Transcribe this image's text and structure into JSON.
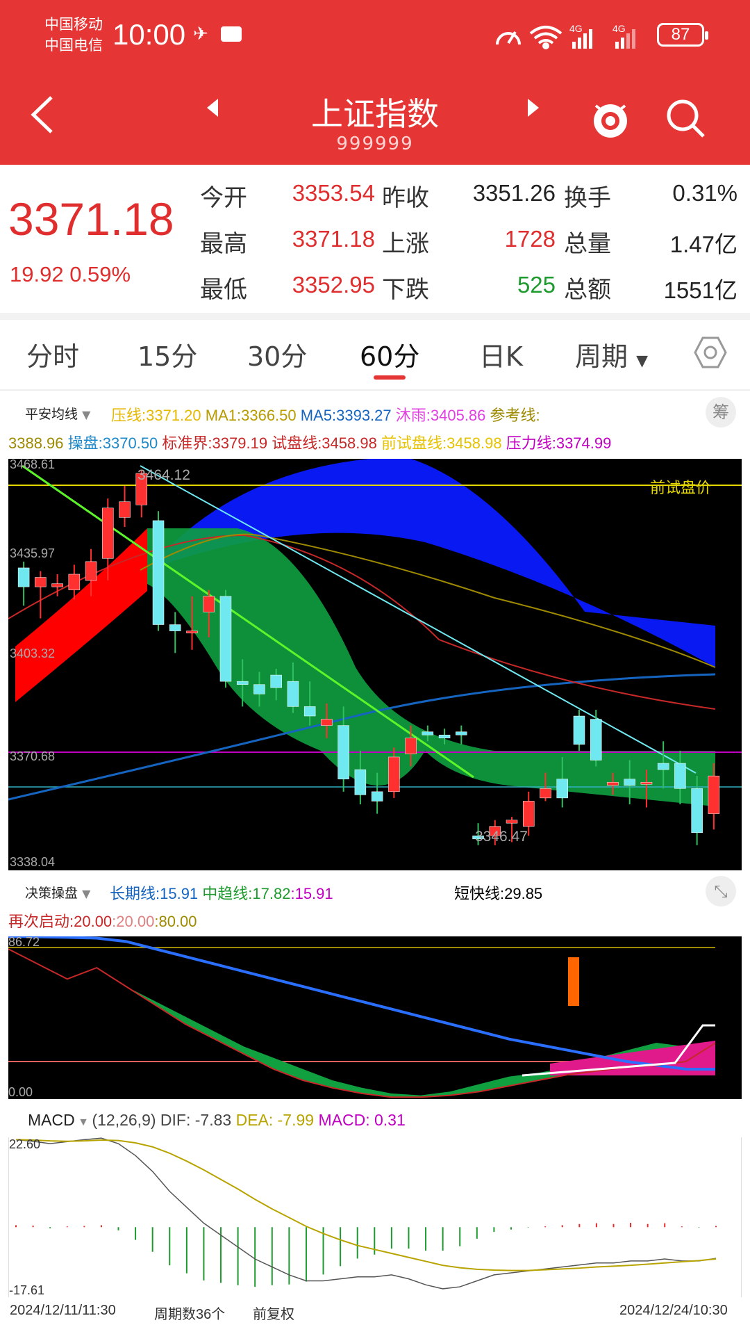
{
  "status_bar": {
    "carrier1": "中国移动",
    "carrier2": "中国电信",
    "time": "10:00",
    "battery": "87"
  },
  "nav": {
    "title": "上证指数",
    "code": "999999"
  },
  "quote": {
    "last_price": "3371.18",
    "change": "19.92 0.59%",
    "fields": [
      {
        "label": "今开",
        "value": "3353.54",
        "color": "red"
      },
      {
        "label": "昨收",
        "value": "3351.26",
        "color": "black"
      },
      {
        "label": "换手",
        "value": "0.31%",
        "color": "black"
      },
      {
        "label": "最高",
        "value": "3371.18",
        "color": "red"
      },
      {
        "label": "上涨",
        "value": "1728",
        "color": "red"
      },
      {
        "label": "总量",
        "value": "1.47亿",
        "color": "black"
      },
      {
        "label": "最低",
        "value": "3352.95",
        "color": "red"
      },
      {
        "label": "下跌",
        "value": "525",
        "color": "green"
      },
      {
        "label": "总额",
        "value": "1551亿",
        "color": "black"
      }
    ]
  },
  "tabs": [
    "分时",
    "15分",
    "30分",
    "60分",
    "日K",
    "周期"
  ],
  "active_tab": "60分",
  "main_indicator": {
    "name": "平安均线",
    "items_row1": [
      {
        "text": "压线:3371.20",
        "color": "#e6b800"
      },
      {
        "text": "MA1:3366.50",
        "color": "#b89b00"
      },
      {
        "text": "MA5:3393.27",
        "color": "#1565c0"
      },
      {
        "text": "沐雨:3405.86",
        "color": "#e040e0"
      },
      {
        "text": "参考线:",
        "color": "#9e8a00"
      }
    ],
    "items_row2": [
      {
        "text": "3388.96",
        "color": "#9e8a00"
      },
      {
        "text": "操盘:3370.50",
        "color": "#1e88c8"
      },
      {
        "text": "标准界:3379.19",
        "color": "#c62828"
      },
      {
        "text": "试盘线:3458.98",
        "color": "#c62828"
      },
      {
        "text": "前试盘线:3458.98",
        "color": "#e6c200"
      },
      {
        "text": "压力线:3374.99",
        "color": "#c000c0"
      }
    ],
    "ctl_label": "筹"
  },
  "main_chart": {
    "y_top": "3468.61",
    "y_2": "3435.97",
    "y_3": "3403.32",
    "y_4": "3370.68",
    "y_bottom": "3338.04",
    "high_label": "3464.12",
    "low_label": "3346.47",
    "ref_label": "前试盘价",
    "ylim": [
      3338.04,
      3468.61
    ],
    "candles": [
      [
        3434,
        3428,
        3436,
        3422
      ],
      [
        3428,
        3431,
        3433,
        3418
      ],
      [
        3428,
        3429,
        3432,
        3425
      ],
      [
        3427,
        3432,
        3435,
        3424
      ],
      [
        3430,
        3436,
        3440,
        3425
      ],
      [
        3437,
        3453,
        3456,
        3430
      ],
      [
        3450,
        3455,
        3460,
        3447
      ],
      [
        3454,
        3464,
        3465,
        3450
      ],
      [
        3449,
        3416,
        3452,
        3414
      ],
      [
        3416,
        3414,
        3420,
        3407
      ],
      [
        3414,
        3414,
        3425,
        3408
      ],
      [
        3420,
        3425,
        3427,
        3412
      ],
      [
        3425,
        3398,
        3427,
        3396
      ],
      [
        3398,
        3397,
        3405,
        3390
      ],
      [
        3397,
        3394,
        3401,
        3390
      ],
      [
        3400,
        3396,
        3402,
        3392
      ],
      [
        3398,
        3390,
        3404,
        3388
      ],
      [
        3390,
        3387,
        3398,
        3384
      ],
      [
        3384,
        3386,
        3391,
        3380
      ],
      [
        3384,
        3367,
        3390,
        3363
      ],
      [
        3370,
        3362,
        3376,
        3359
      ],
      [
        3363,
        3360,
        3369,
        3356
      ],
      [
        3363,
        3374,
        3377,
        3361
      ],
      [
        3375,
        3380,
        3384,
        3371
      ],
      [
        3382,
        3381,
        3384,
        3379
      ],
      [
        3381,
        3380,
        3383,
        3378
      ],
      [
        3382,
        3381,
        3384,
        3378
      ],
      [
        3349,
        3348,
        3353,
        3346
      ],
      [
        3349,
        3352,
        3354,
        3346
      ],
      [
        3353,
        3354,
        3355,
        3347
      ],
      [
        3352,
        3360,
        3363,
        3349
      ],
      [
        3361,
        3364,
        3369,
        3360
      ],
      [
        3367,
        3361,
        3374,
        3358
      ],
      [
        3387,
        3378,
        3389,
        3376
      ],
      [
        3386,
        3373,
        3389,
        3371
      ],
      [
        3365,
        3366,
        3369,
        3362
      ],
      [
        3367,
        3365,
        3373,
        3359
      ],
      [
        3366,
        3366,
        3370,
        3358
      ],
      [
        3372,
        3370,
        3379,
        3364
      ],
      [
        3372,
        3364,
        3376,
        3359
      ],
      [
        3364,
        3350,
        3368,
        3346
      ],
      [
        3356,
        3368,
        3372,
        3351
      ]
    ]
  },
  "decision_indicator": {
    "name": "决策操盘",
    "long_line": "长期线:15.91",
    "mid_line": "中趋线:17.82",
    "mid_val": ":15.91",
    "short_line": "短快线:29.85",
    "restart_label": "再次启动:20.00",
    "restart_v2": ":20.00",
    "restart_v3": ":80.00",
    "y_top": "86.72",
    "y_bottom": "0.00",
    "expand_label": "⤡",
    "ylim": [
      0,
      86.72
    ],
    "long_series": [
      86.7,
      86.5,
      86.2,
      85.8,
      84,
      80,
      76,
      72,
      68,
      64,
      60,
      56,
      52,
      48,
      44,
      40,
      36,
      32,
      29,
      26,
      23,
      20,
      18,
      16,
      15.9
    ],
    "mid_series": [
      80,
      72,
      64,
      70,
      60,
      52,
      44,
      36,
      28,
      22,
      16,
      10,
      6,
      3,
      2,
      4,
      8,
      12,
      14,
      17,
      22,
      26,
      30,
      28,
      17.8
    ],
    "short_series": [
      80,
      72,
      64,
      70,
      60,
      50,
      40,
      32,
      24,
      16,
      10,
      6,
      3,
      1,
      1,
      2,
      4,
      7,
      10,
      13,
      15,
      17,
      18,
      20,
      29.85
    ]
  },
  "macd": {
    "name": "MACD",
    "params": "(12,26,9)",
    "dif": "DIF: -7.83",
    "dea": "DEA: -7.99",
    "macd": "MACD: 0.31",
    "y_top": "22.60",
    "y_bottom": "-17.61",
    "ylim": [
      -17.61,
      22.6
    ],
    "dif_series": [
      22.0,
      21.6,
      21.0,
      21.5,
      22.0,
      22.4,
      21.0,
      18.0,
      14.0,
      9.0,
      5.0,
      1.0,
      -2.0,
      -5.0,
      -8.0,
      -10.0,
      -12.0,
      -13.5,
      -13.5,
      -13.0,
      -12.5,
      -12.5,
      -12.0,
      -13.0,
      -14.5,
      -15.5,
      -15.0,
      -13.5,
      -12.0,
      -11.5,
      -11.0,
      -10.5,
      -10.0,
      -9.5,
      -9.0,
      -9.0,
      -8.5,
      -8.5,
      -8.0,
      -8.5,
      -8.5,
      -7.83
    ],
    "dea_series": [
      22.0,
      21.9,
      21.7,
      21.6,
      21.7,
      21.9,
      21.8,
      21.2,
      20.2,
      18.6,
      16.6,
      14.4,
      12.0,
      9.6,
      7.0,
      4.6,
      2.4,
      0.2,
      -1.6,
      -3.2,
      -4.6,
      -5.6,
      -6.6,
      -7.6,
      -8.6,
      -9.6,
      -10.2,
      -10.6,
      -10.8,
      -10.9,
      -10.9,
      -10.7,
      -10.5,
      -10.3,
      -10.0,
      -9.8,
      -9.6,
      -9.3,
      -9.0,
      -8.7,
      -8.4,
      -7.99
    ],
    "hist": [
      0.5,
      0.4,
      -0.3,
      0.2,
      0.3,
      0.5,
      -0.8,
      -3.2,
      -6.2,
      -9.6,
      -11.6,
      -13.4,
      -14.0,
      -14.6,
      -15.0,
      -14.6,
      -14.4,
      -13.7,
      -11.9,
      -9.8,
      -7.9,
      -6.9,
      -5.4,
      -5.4,
      -5.9,
      -5.9,
      -4.8,
      -2.9,
      -1.2,
      -0.6,
      -0.1,
      0.2,
      0.5,
      0.8,
      1.0,
      0.8,
      1.1,
      0.8,
      1.0,
      0.2,
      -0.1,
      0.31
    ]
  },
  "bottom_bar": {
    "start": "2024/12/11/11:30",
    "period_count": "周期数36个",
    "adjust": "前复权",
    "end": "2024/12/24/10:30"
  }
}
